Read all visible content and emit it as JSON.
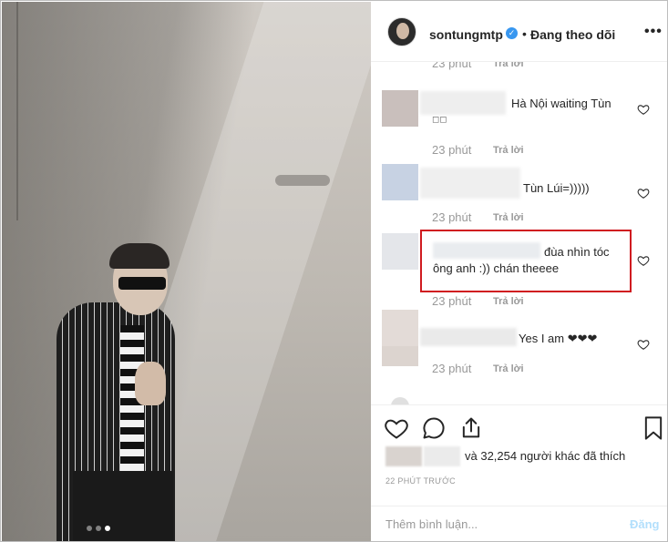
{
  "post": {
    "username": "sontungmtp",
    "separator": "•",
    "follow_state": "Đang theo dõi",
    "more_glyph": "•••",
    "verified_glyph": "✓"
  },
  "comments": {
    "partial_top": {
      "time": "23 phút",
      "reply": "Trả lời"
    },
    "items": [
      {
        "text": "Hà Nội waiting Tùn",
        "text2": "◻◻",
        "time": "23 phút",
        "reply": "Trả lời"
      },
      {
        "text": "Tùn Lúi=)))))",
        "time": "23 phút",
        "reply": "Trả lời"
      },
      {
        "text": "đùa nhìn tóc",
        "text2": "ông anh :)) chán theeee",
        "time": "23 phút",
        "reply": "Trả lời"
      },
      {
        "text": "Yes I am ❤❤❤",
        "time": "23 phút",
        "reply": "Trả lời"
      }
    ],
    "highlight_color": "#d01b20"
  },
  "footer": {
    "likes_text": "và 32,254 người khác đã thích",
    "time_ago": "22 PHÚT TRƯỚC",
    "add_comment_placeholder": "Thêm bình luận...",
    "post_button": "Đăng"
  },
  "photo": {
    "carousel_total": 3,
    "carousel_active": 3
  },
  "colors": {
    "accent": "#3897f0",
    "muted": "#999999",
    "post_disabled": "#b2dffc"
  }
}
